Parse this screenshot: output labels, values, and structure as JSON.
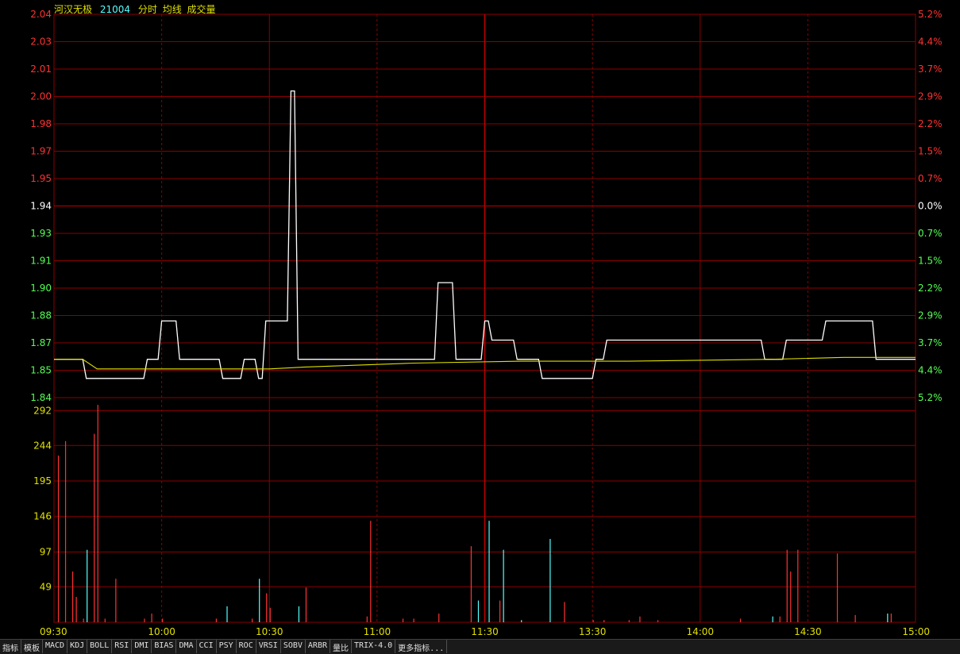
{
  "header": {
    "stock_name": "河汉无极",
    "stock_code": "21004",
    "label_fenshi": "分时",
    "label_junxian": "均线",
    "label_volume": "成交量"
  },
  "colors": {
    "background": "#000000",
    "grid": "#8b0000",
    "up": "#ff3232",
    "down": "#54ff54",
    "neutral": "#ffffff",
    "avg_line": "#e0e000",
    "price_line": "#ffffff",
    "volume_up": "#ff3232",
    "volume_down": "#54ffff",
    "time_labels": "#e0e000",
    "volume_axis": "#e0e000"
  },
  "price_axis": [
    "2.04",
    "2.03",
    "2.01",
    "2.00",
    "1.98",
    "1.97",
    "1.95",
    "1.94",
    "1.93",
    "1.91",
    "1.90",
    "1.88",
    "1.87",
    "1.85",
    "1.84"
  ],
  "pct_axis": [
    "5.2%",
    "4.4%",
    "3.7%",
    "2.9%",
    "2.2%",
    "1.5%",
    "0.7%",
    "0.0%",
    "0.7%",
    "1.5%",
    "2.2%",
    "2.9%",
    "3.7%",
    "4.4%",
    "5.2%"
  ],
  "volume_axis": [
    "292",
    "244",
    "195",
    "146",
    "97",
    "49"
  ],
  "time_axis": [
    "09:30",
    "10:00",
    "10:30",
    "11:00",
    "11:30",
    "13:30",
    "14:00",
    "14:30",
    "15:00"
  ],
  "tabs": [
    "指标",
    "模板",
    "MACD",
    "KDJ",
    "BOLL",
    "RSI",
    "DMI",
    "BIAS",
    "DMA",
    "CCI",
    "PSY",
    "ROC",
    "VRSI",
    "SOBV",
    "ARBR",
    "量比",
    "TRIX-4.0",
    "更多指标..."
  ],
  "chart_data": {
    "type": "line",
    "title": "",
    "xlabel": "",
    "ylabel": "",
    "ylim": [
      1.84,
      2.04
    ],
    "prev_close": 1.94,
    "x": [
      "09:30",
      "10:00",
      "10:30",
      "11:00",
      "11:30",
      "13:30",
      "14:00",
      "14:30",
      "15:00"
    ],
    "series": [
      {
        "points": [
          [
            0,
            1.86
          ],
          [
            8,
            1.86
          ],
          [
            9,
            1.85
          ],
          [
            25,
            1.85
          ],
          [
            26,
            1.86
          ],
          [
            29,
            1.86
          ],
          [
            30,
            1.88
          ],
          [
            34,
            1.88
          ],
          [
            35,
            1.86
          ],
          [
            46,
            1.86
          ],
          [
            47,
            1.85
          ],
          [
            52,
            1.85
          ],
          [
            53,
            1.86
          ],
          [
            56,
            1.86
          ],
          [
            57,
            1.85
          ],
          [
            58,
            1.85
          ],
          [
            59,
            1.88
          ],
          [
            65,
            1.88
          ],
          [
            66,
            2.0
          ],
          [
            67,
            2.0
          ],
          [
            68,
            1.86
          ],
          [
            87,
            1.86
          ],
          [
            88,
            1.86
          ],
          [
            89,
            1.86
          ],
          [
            106,
            1.86
          ],
          [
            107,
            1.9
          ],
          [
            111,
            1.9
          ],
          [
            112,
            1.86
          ],
          [
            118,
            1.86
          ],
          [
            119,
            1.86
          ],
          [
            120,
            1.88
          ],
          [
            121,
            1.88
          ],
          [
            122,
            1.87
          ],
          [
            126,
            1.87
          ],
          [
            128,
            1.87
          ],
          [
            129,
            1.86
          ],
          [
            134,
            1.86
          ],
          [
            135,
            1.86
          ],
          [
            136,
            1.85
          ],
          [
            150,
            1.85
          ],
          [
            151,
            1.86
          ],
          [
            153,
            1.86
          ],
          [
            154,
            1.87
          ],
          [
            197,
            1.87
          ],
          [
            198,
            1.86
          ],
          [
            203,
            1.86
          ],
          [
            204,
            1.87
          ],
          [
            214,
            1.87
          ],
          [
            215,
            1.88
          ],
          [
            218,
            1.88
          ],
          [
            219,
            1.88
          ],
          [
            228,
            1.88
          ],
          [
            229,
            1.86
          ],
          [
            240,
            1.86
          ]
        ]
      },
      {
        "points": [
          [
            0,
            1.86
          ],
          [
            8,
            1.86
          ],
          [
            12,
            1.855
          ],
          [
            30,
            1.855
          ],
          [
            60,
            1.855
          ],
          [
            70,
            1.856
          ],
          [
            100,
            1.858
          ],
          [
            130,
            1.859
          ],
          [
            160,
            1.859
          ],
          [
            200,
            1.86
          ],
          [
            220,
            1.861
          ],
          [
            240,
            1.861
          ]
        ]
      }
    ],
    "volume": {
      "ylim": [
        0,
        310
      ],
      "bars": [
        [
          1,
          230,
          "up"
        ],
        [
          3,
          250,
          "up"
        ],
        [
          5,
          70,
          "up"
        ],
        [
          6,
          35,
          "up"
        ],
        [
          8,
          5,
          "up"
        ],
        [
          9,
          100,
          "down"
        ],
        [
          11,
          260,
          "up"
        ],
        [
          12,
          300,
          "up"
        ],
        [
          14,
          5,
          "up"
        ],
        [
          17,
          60,
          "up"
        ],
        [
          25,
          5,
          "up"
        ],
        [
          27,
          12,
          "up"
        ],
        [
          30,
          5,
          "up"
        ],
        [
          45,
          5,
          "up"
        ],
        [
          48,
          22,
          "down"
        ],
        [
          55,
          5,
          "up"
        ],
        [
          57,
          60,
          "down"
        ],
        [
          59,
          40,
          "up"
        ],
        [
          60,
          20,
          "up"
        ],
        [
          68,
          22,
          "down"
        ],
        [
          70,
          48,
          "up"
        ],
        [
          87,
          8,
          "up"
        ],
        [
          88,
          140,
          "up"
        ],
        [
          97,
          5,
          "up"
        ],
        [
          100,
          5,
          "up"
        ],
        [
          107,
          12,
          "up"
        ],
        [
          116,
          105,
          "up"
        ],
        [
          118,
          30,
          "down"
        ],
        [
          121,
          140,
          "down"
        ],
        [
          124,
          30,
          "up"
        ],
        [
          125,
          100,
          "down"
        ],
        [
          130,
          3,
          "down"
        ],
        [
          138,
          115,
          "down"
        ],
        [
          142,
          28,
          "up"
        ],
        [
          150,
          3,
          "up"
        ],
        [
          153,
          3,
          "up"
        ],
        [
          160,
          3,
          "up"
        ],
        [
          163,
          8,
          "up"
        ],
        [
          168,
          3,
          "up"
        ],
        [
          191,
          5,
          "up"
        ],
        [
          200,
          8,
          "down"
        ],
        [
          202,
          8,
          "up"
        ],
        [
          204,
          100,
          "up"
        ],
        [
          205,
          70,
          "up"
        ],
        [
          207,
          100,
          "up"
        ],
        [
          218,
          95,
          "up"
        ],
        [
          223,
          10,
          "up"
        ],
        [
          232,
          12,
          "down"
        ],
        [
          233,
          12,
          "up"
        ]
      ]
    }
  }
}
